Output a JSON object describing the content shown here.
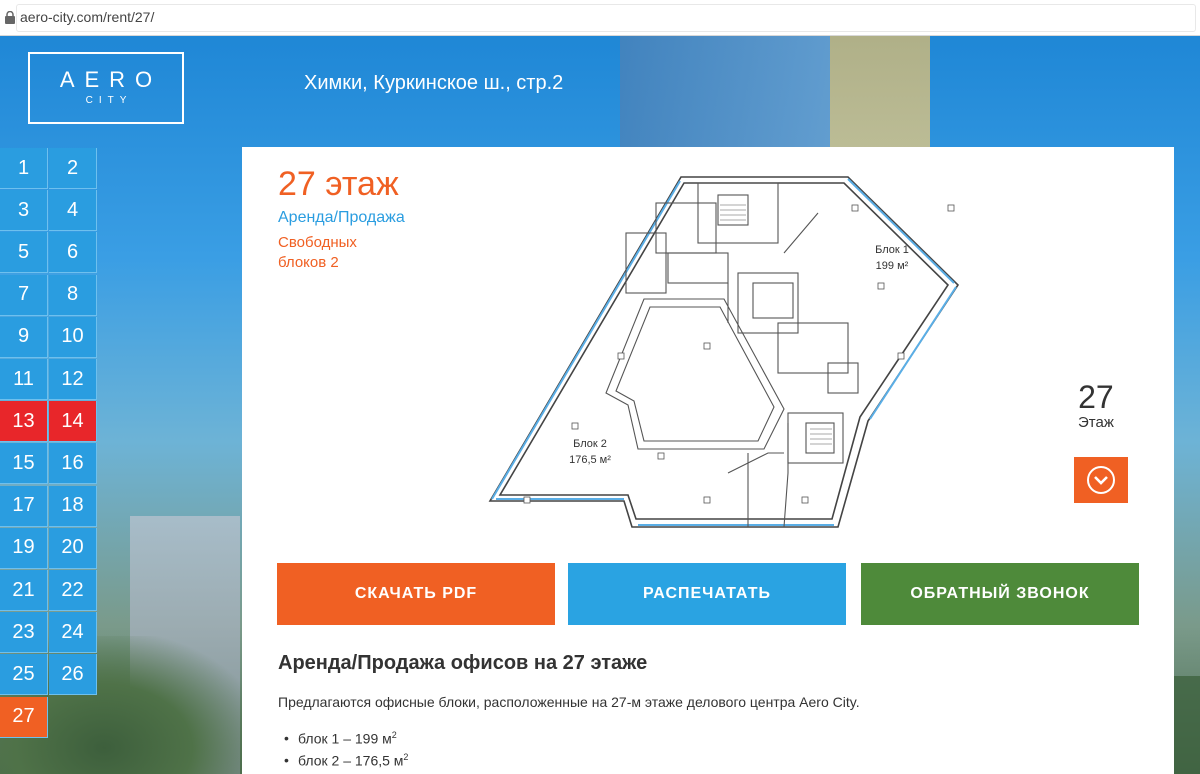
{
  "browser": {
    "url": "aero-city.com/rent/27/"
  },
  "logo": {
    "main": "AERO",
    "sub": "CITY"
  },
  "header": {
    "address": "Химки, Куркинское ш., стр.2"
  },
  "floors": [
    "1",
    "2",
    "3",
    "4",
    "5",
    "6",
    "7",
    "8",
    "9",
    "10",
    "11",
    "12",
    "13",
    "14",
    "15",
    "16",
    "17",
    "18",
    "19",
    "20",
    "21",
    "22",
    "23",
    "24",
    "25",
    "26",
    "27"
  ],
  "highlighted_floors": [
    "13",
    "14"
  ],
  "current_floor": "27",
  "main": {
    "title": "27 этаж",
    "deal_type": "Аренда/Продажа",
    "free_blocks": "Свободных блоков 2",
    "plan": {
      "block1_name": "Блок 1",
      "block1_area": "199 м²",
      "block2_name": "Блок 2",
      "block2_area": "176,5 м²"
    },
    "floor_number": "27",
    "floor_label": "Этаж",
    "buttons": {
      "pdf": "СКАЧАТЬ PDF",
      "print": "РАСПЕЧАТАТЬ",
      "call": "ОБРАТНЫЙ ЗВОНОК"
    },
    "description": {
      "title": "Аренда/Продажа офисов на 27 этаже",
      "text": "Предлагаются офисные блоки, расположенные на 27-м этаже делового центра Aero City.",
      "items": [
        {
          "text": "блок 1 – 199 м",
          "sup": "2"
        },
        {
          "text": "блок 2 – 176,5 м",
          "sup": "2"
        }
      ]
    }
  },
  "colors": {
    "orange": "#f06023",
    "blue": "#2a9de0",
    "green": "#4e8a3a",
    "red": "#e8262a"
  }
}
